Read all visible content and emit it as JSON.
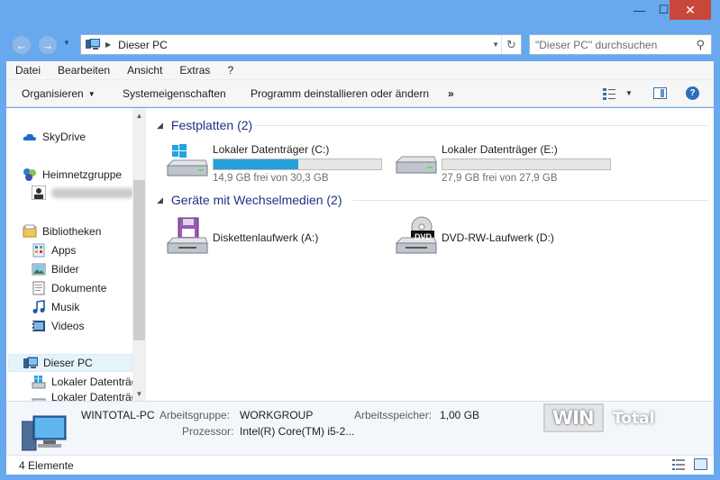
{
  "window": {
    "minimize_glyph": "—",
    "maximize_glyph": "☐",
    "close_glyph": "✕"
  },
  "address": {
    "back_glyph": "←",
    "forward_glyph": "→",
    "path": "Dieser PC",
    "refresh_glyph": "↻",
    "search_placeholder": "\"Dieser PC\" durchsuchen"
  },
  "menu": [
    "Datei",
    "Bearbeiten",
    "Ansicht",
    "Extras",
    "?"
  ],
  "commands": {
    "organize": "Organisieren",
    "system_properties": "Systemeigenschaften",
    "uninstall": "Programm deinstallieren oder ändern",
    "more": "»",
    "help": "?"
  },
  "nav": {
    "skydrive": "SkyDrive",
    "homegroup": "Heimnetzgruppe",
    "libraries": "Bibliotheken",
    "apps": "Apps",
    "pictures": "Bilder",
    "documents": "Dokumente",
    "music": "Musik",
    "videos": "Videos",
    "this_pc": "Dieser PC",
    "local_disk": "Lokaler Datenträger (C:)",
    "local_disk2": "Lokaler Datenträger (E:)"
  },
  "groups": {
    "hard_disks": "Festplatten (2)",
    "removable": "Geräte mit Wechselmedien (2)"
  },
  "drives": [
    {
      "name": "Lokaler Datenträger (C:)",
      "free_text": "14,9 GB frei von 30,3 GB",
      "used_fraction": 0.508
    },
    {
      "name": "Lokaler Datenträger (E:)",
      "free_text": "27,9 GB frei von 27,9 GB",
      "used_fraction": 0.0
    }
  ],
  "devices": [
    {
      "name": "Diskettenlaufwerk (A:)"
    },
    {
      "name": "DVD-RW-Laufwerk (D:)",
      "badge": "DVD"
    }
  ],
  "details": {
    "pc_name": "WINTOTAL-PC",
    "workgroup_label": "Arbeitsgruppe:",
    "workgroup_value": "WORKGROUP",
    "ram_label": "Arbeitsspeicher:",
    "ram_value": "1,00 GB",
    "cpu_label": "Prozessor:",
    "cpu_value": "Intel(R) Core(TM) i5-2...",
    "watermark_win": "WIN",
    "watermark_total": "Total"
  },
  "status": {
    "count": "4 Elemente"
  },
  "colors": {
    "accent": "#26a0da",
    "group_header": "#1e3287",
    "close_button": "#c7473b",
    "window_frame": "#68a8ee"
  }
}
